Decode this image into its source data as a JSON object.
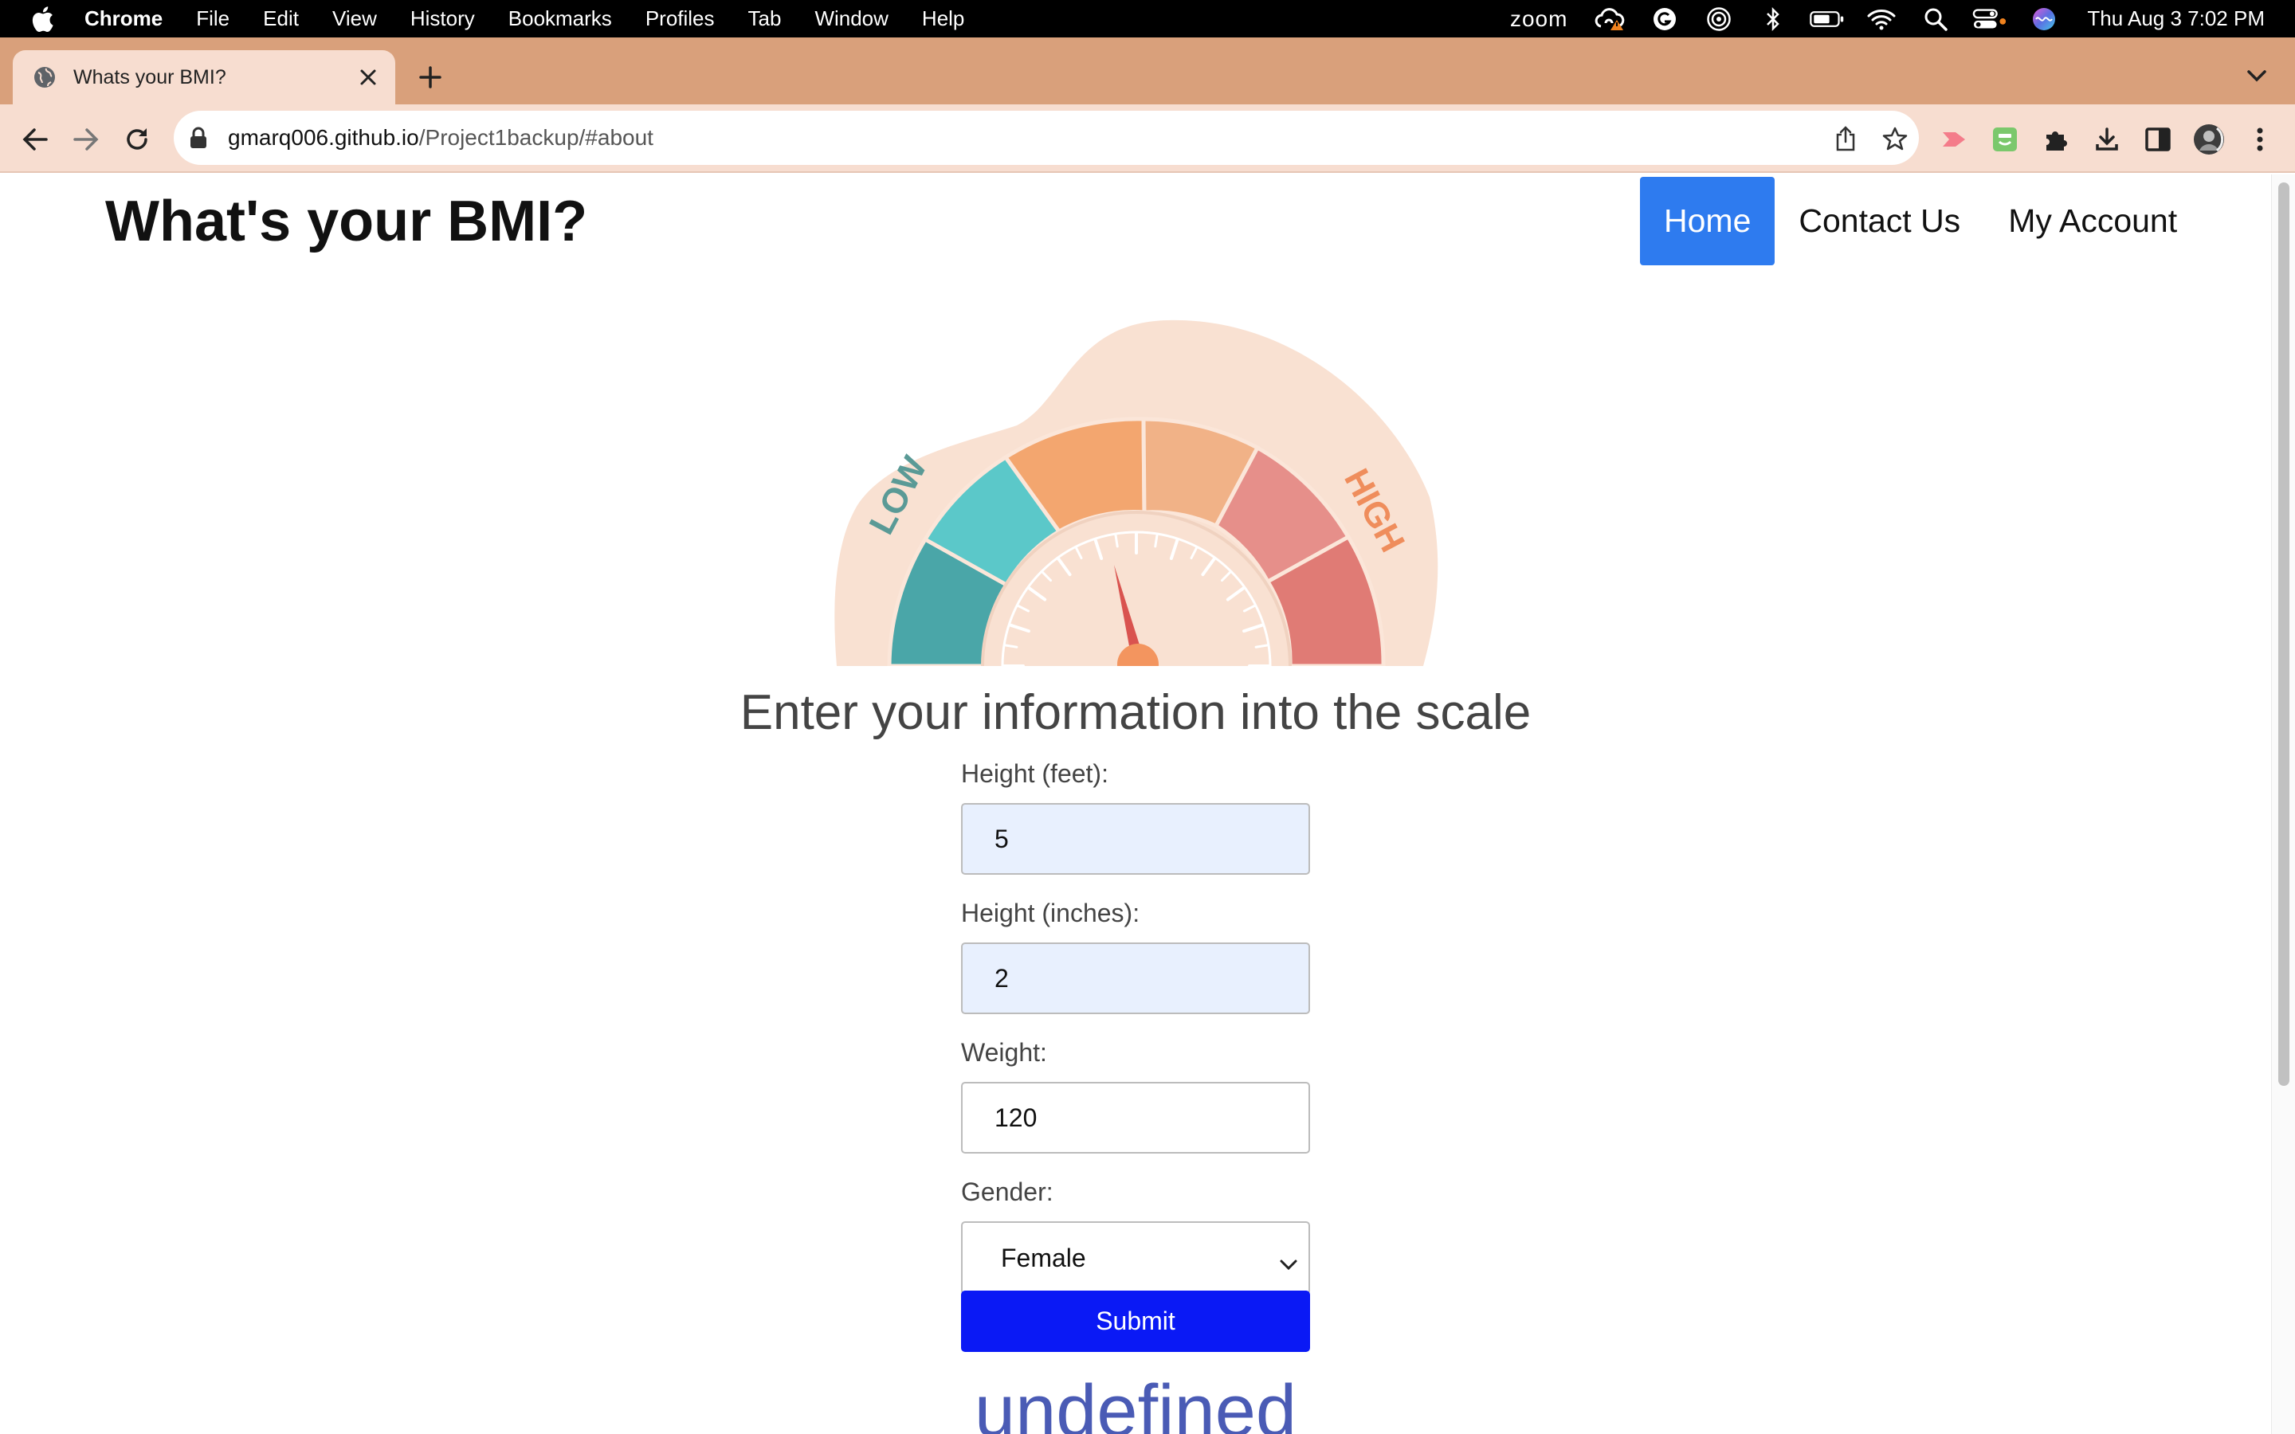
{
  "menubar": {
    "app": "Chrome",
    "menus": [
      "File",
      "Edit",
      "View",
      "History",
      "Bookmarks",
      "Profiles",
      "Tab",
      "Window",
      "Help"
    ],
    "zoom_label": "zoom",
    "clock": "Thu Aug 3  7:02 PM"
  },
  "tab": {
    "title": "Whats your BMI?"
  },
  "toolbar": {
    "url_host": "gmarq006.github.io",
    "url_path": "/Project1backup/#about"
  },
  "site": {
    "title": "What's your BMI?",
    "nav": {
      "home": "Home",
      "contact": "Contact Us",
      "account": "My Account"
    }
  },
  "gauge": {
    "low_label": "LOW",
    "high_label": "HIGH"
  },
  "form": {
    "heading": "Enter your information into the scale",
    "height_feet_label": "Height (feet):",
    "height_feet_value": "5",
    "height_inches_label": "Height (inches):",
    "height_inches_value": "2",
    "weight_label": "Weight:",
    "weight_value": "120",
    "gender_label": "Gender:",
    "gender_value": "Female",
    "submit_label": "Submit"
  },
  "result": {
    "text": "undefined"
  },
  "colors": {
    "nav_active": "#2e7bef",
    "submit": "#0a19f5",
    "result": "#4a5bb5",
    "tab_strip": "#d9a07b",
    "toolbar": "#f7ddd0"
  }
}
